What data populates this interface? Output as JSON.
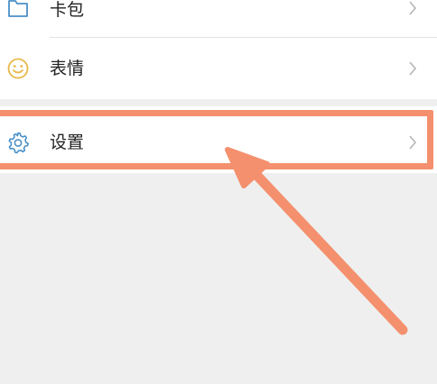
{
  "menu": {
    "items": [
      {
        "label": "卡包",
        "icon": "card-wallet-icon"
      },
      {
        "label": "表情",
        "icon": "smiley-face-icon"
      },
      {
        "label": "设置",
        "icon": "gear-icon"
      }
    ]
  },
  "colors": {
    "highlight": "#f4906d",
    "cardIcon": "#4a90c8",
    "smileyIcon": "#e8b94a",
    "gearIcon": "#4a90c8",
    "chevron": "#b5b5b5",
    "background": "#efefef"
  }
}
